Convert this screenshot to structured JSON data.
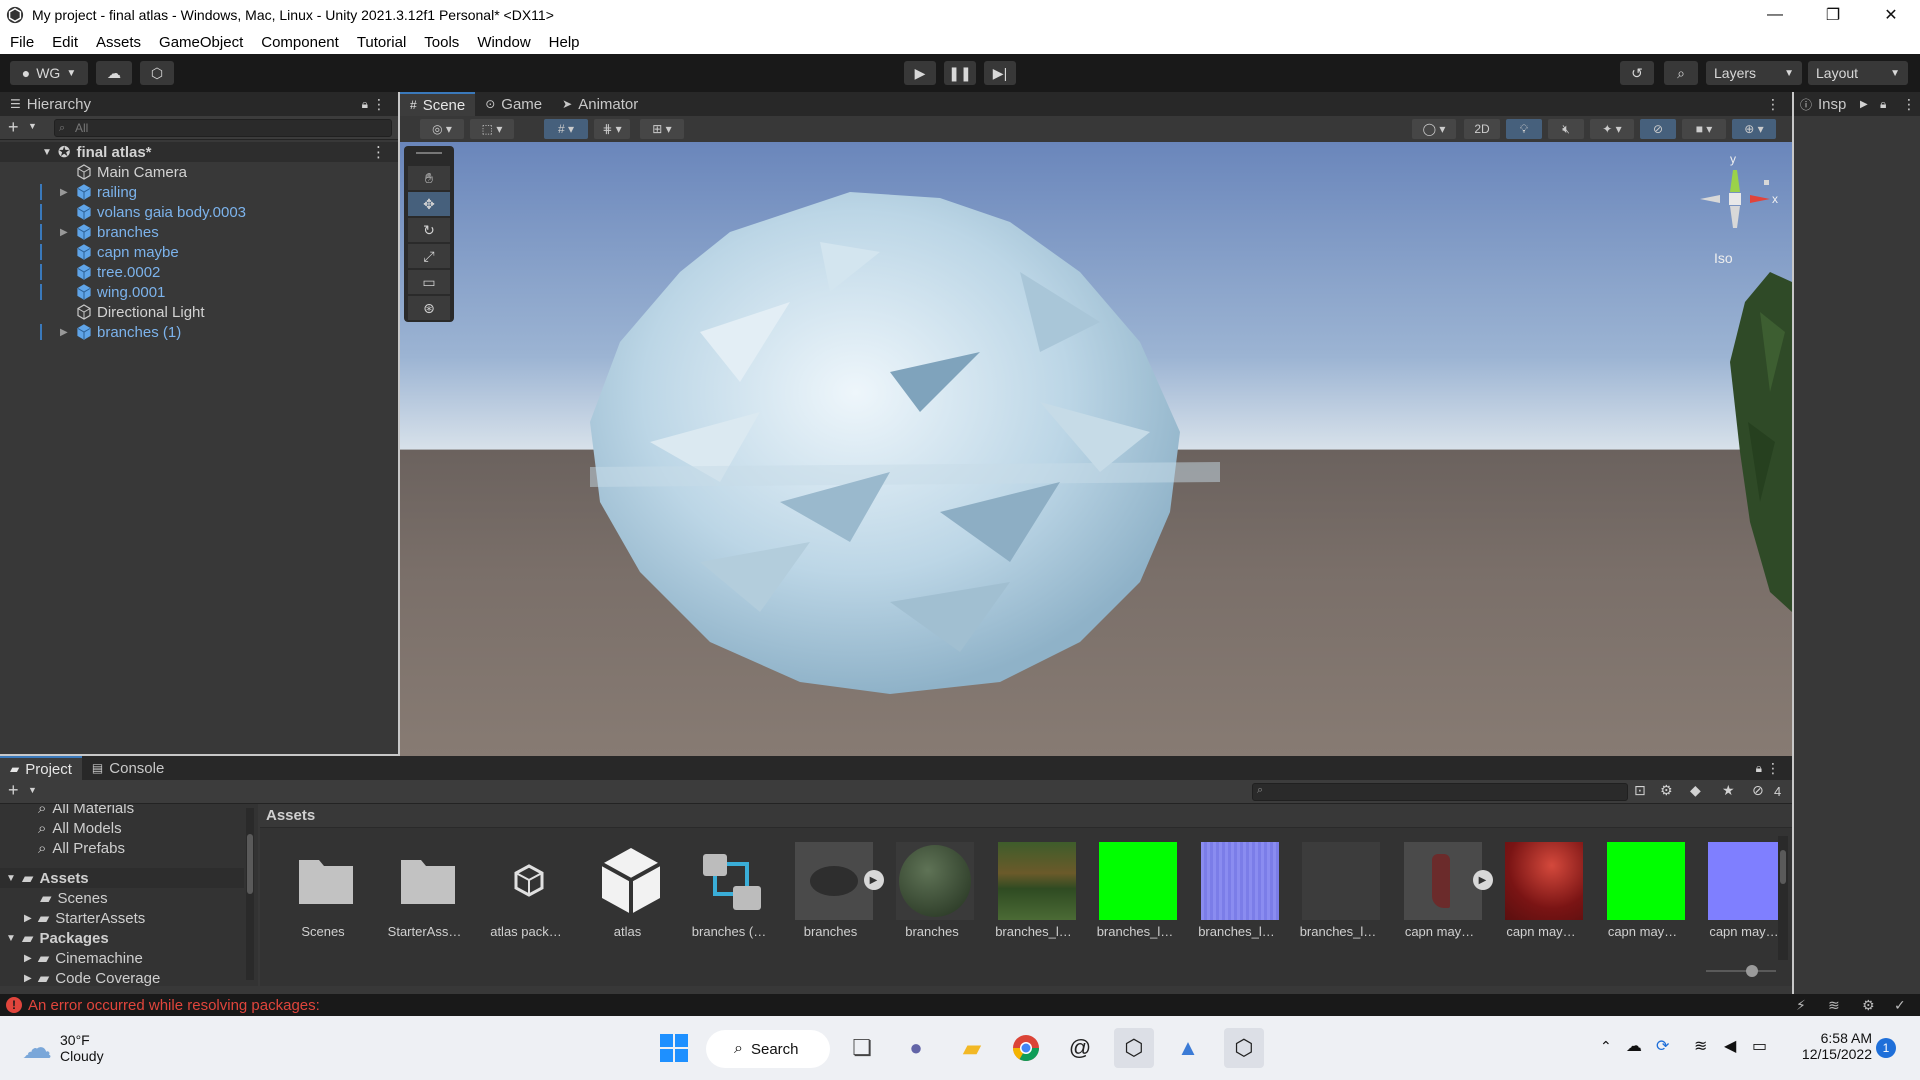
{
  "window": {
    "title": "My project - final atlas - Windows, Mac, Linux - Unity 2021.3.12f1 Personal* <DX11>",
    "controls": [
      "—",
      "❐",
      "✕"
    ]
  },
  "menu": [
    "File",
    "Edit",
    "Assets",
    "GameObject",
    "Component",
    "Tutorial",
    "Tools",
    "Window",
    "Help"
  ],
  "toolbar": {
    "account_label": "WG",
    "layers_label": "Layers",
    "layout_label": "Layout"
  },
  "hierarchy": {
    "tab_label": "Hierarchy",
    "search_placeholder": "All",
    "scene_name": "final atlas*",
    "items": [
      {
        "label": "Main Camera",
        "prefab": false,
        "expandable": false
      },
      {
        "label": "railing",
        "prefab": true,
        "expandable": true
      },
      {
        "label": "volans gaia body.0003",
        "prefab": true,
        "expandable": false
      },
      {
        "label": "branches",
        "prefab": true,
        "expandable": true
      },
      {
        "label": "capn maybe",
        "prefab": true,
        "expandable": false
      },
      {
        "label": "tree.0002",
        "prefab": true,
        "expandable": false
      },
      {
        "label": "wing.0001",
        "prefab": true,
        "expandable": false
      },
      {
        "label": "Directional Light",
        "prefab": false,
        "expandable": false
      },
      {
        "label": "branches (1)",
        "prefab": true,
        "expandable": true
      }
    ]
  },
  "scene_tabs": [
    {
      "label": "Scene",
      "active": true
    },
    {
      "label": "Game",
      "active": false
    },
    {
      "label": "Animator",
      "active": false
    }
  ],
  "scene_toolbar": {
    "mode_2d": "2D"
  },
  "gizmo": {
    "y_label": "y",
    "x_label": "x",
    "projection": "Iso"
  },
  "inspector": {
    "tab_label": "Insp"
  },
  "project": {
    "tabs": [
      {
        "label": "Project",
        "active": true
      },
      {
        "label": "Console",
        "active": false
      }
    ],
    "hidden_count": "4",
    "tree": [
      {
        "label": "All Materials",
        "type": "search"
      },
      {
        "label": "All Models",
        "type": "search"
      },
      {
        "label": "All Prefabs",
        "type": "search"
      },
      {
        "label": "Assets",
        "type": "root"
      },
      {
        "label": "Scenes",
        "type": "folder"
      },
      {
        "label": "StarterAssets",
        "type": "folder"
      },
      {
        "label": "Packages",
        "type": "root"
      },
      {
        "label": "Cinemachine",
        "type": "folder"
      },
      {
        "label": "Code Coverage",
        "type": "folder"
      }
    ],
    "breadcrumb": "Assets",
    "assets": [
      {
        "label": "Scenes",
        "kind": "folder"
      },
      {
        "label": "StarterAss…",
        "kind": "folder"
      },
      {
        "label": "atlas pack…",
        "kind": "package"
      },
      {
        "label": "atlas",
        "kind": "unity"
      },
      {
        "label": "branches (…",
        "kind": "prefab-variant"
      },
      {
        "label": "branches",
        "kind": "model"
      },
      {
        "label": "branches",
        "kind": "material"
      },
      {
        "label": "branches_l…",
        "kind": "tex-forest"
      },
      {
        "label": "branches_l…",
        "kind": "tex-green"
      },
      {
        "label": "branches_l…",
        "kind": "tex-normal"
      },
      {
        "label": "branches_l…",
        "kind": "tex-dark"
      },
      {
        "label": "capn may…",
        "kind": "model-capn"
      },
      {
        "label": "capn may…",
        "kind": "tex-red"
      },
      {
        "label": "capn may…",
        "kind": "tex-green"
      },
      {
        "label": "capn may…",
        "kind": "tex-violet"
      }
    ]
  },
  "status": {
    "error": "An error occurred while resolving packages:"
  },
  "taskbar": {
    "weather_temp": "30°F",
    "weather_desc": "Cloudy",
    "search_label": "Search",
    "time": "6:58 AM",
    "date": "12/15/2022",
    "notification_count": "1"
  },
  "colors": {
    "accent_blue": "#3a79bb",
    "prefab_blue": "#7cb3ec",
    "error_red": "#e0453c",
    "tex_green": "#00ff00",
    "tex_violet": "#7f7fff"
  }
}
